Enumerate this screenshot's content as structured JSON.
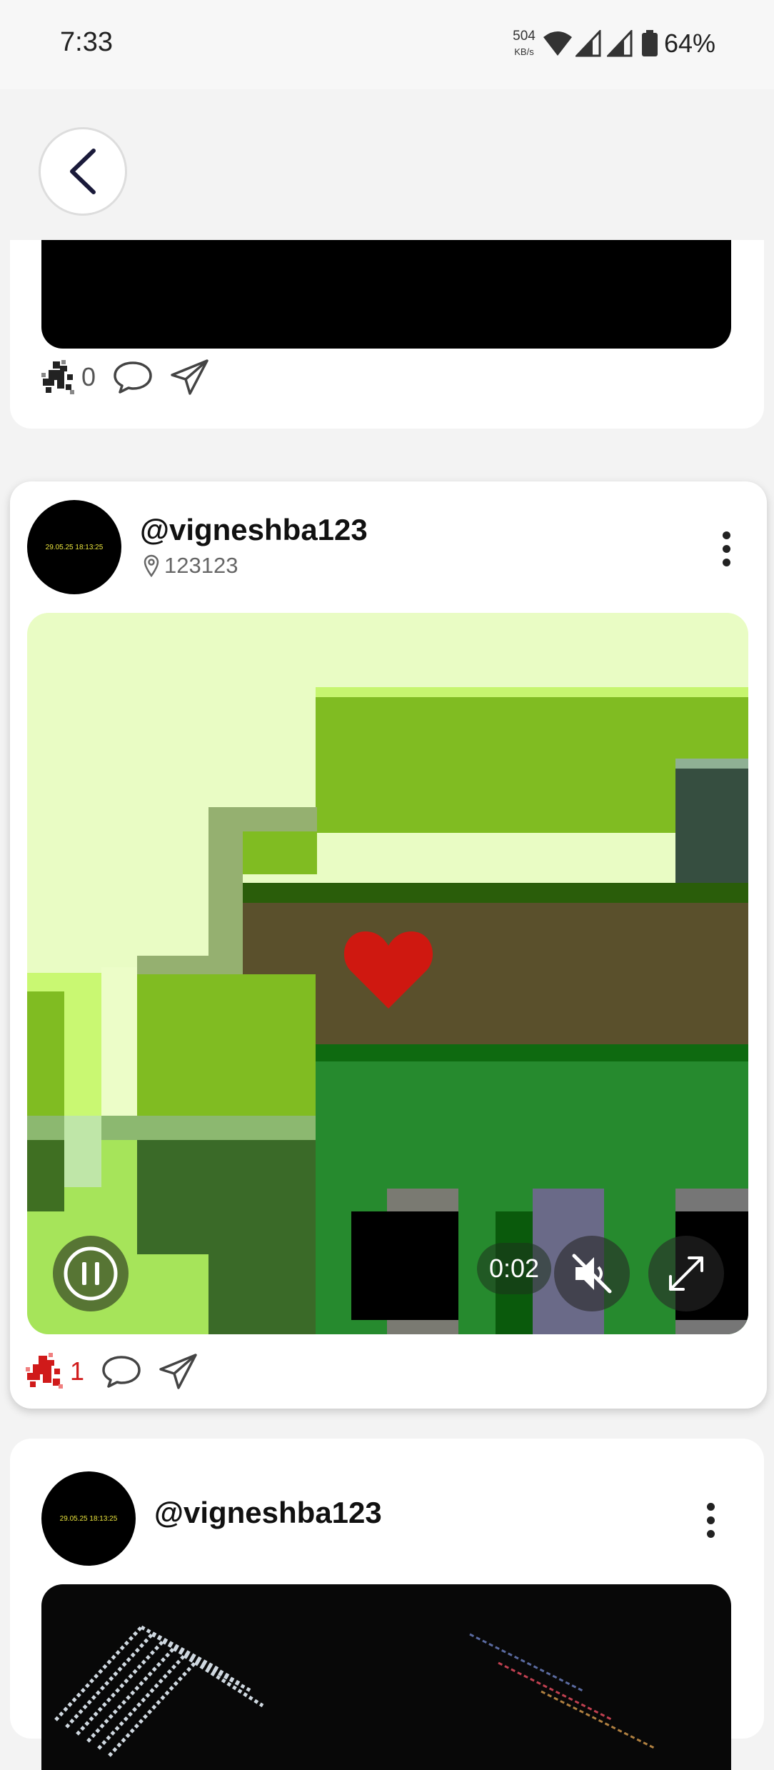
{
  "status_bar": {
    "time": "7:33",
    "net_speed": "504",
    "net_unit": "KB/s",
    "battery": "64%"
  },
  "posts": [
    {
      "like_count": "0"
    },
    {
      "avatar_text": "29.05.25 18:13:25",
      "username": "@vigneshba123",
      "location": "123123",
      "video_time": "0:02",
      "like_count": "1"
    },
    {
      "avatar_text": "29.05.25 18:13:25",
      "username": "@vigneshba123"
    }
  ],
  "colors": {
    "liked": "#d01a1a",
    "text": "#111111"
  }
}
